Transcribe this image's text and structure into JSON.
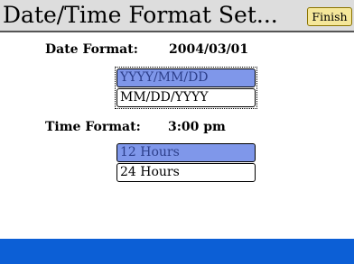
{
  "title_bar": {
    "title": "Date/Time Format Set...",
    "finish_label": "Finish"
  },
  "date_format": {
    "label": "Date Format:",
    "value": "2004/03/01",
    "options": [
      {
        "label": "YYYY/MM/DD",
        "selected": true
      },
      {
        "label": "MM/DD/YYYY",
        "selected": false
      }
    ]
  },
  "time_format": {
    "label": "Time Format:",
    "value": "3:00 pm",
    "options": [
      {
        "label": "12 Hours",
        "selected": true
      },
      {
        "label": "24 Hours",
        "selected": false
      }
    ]
  },
  "colors": {
    "title_bar_bg": "#dddddd",
    "finish_button_bg": "#f5e79a",
    "selected_option_bg": "#7f97ea",
    "bottom_bar_bg": "#0c5fd6"
  }
}
